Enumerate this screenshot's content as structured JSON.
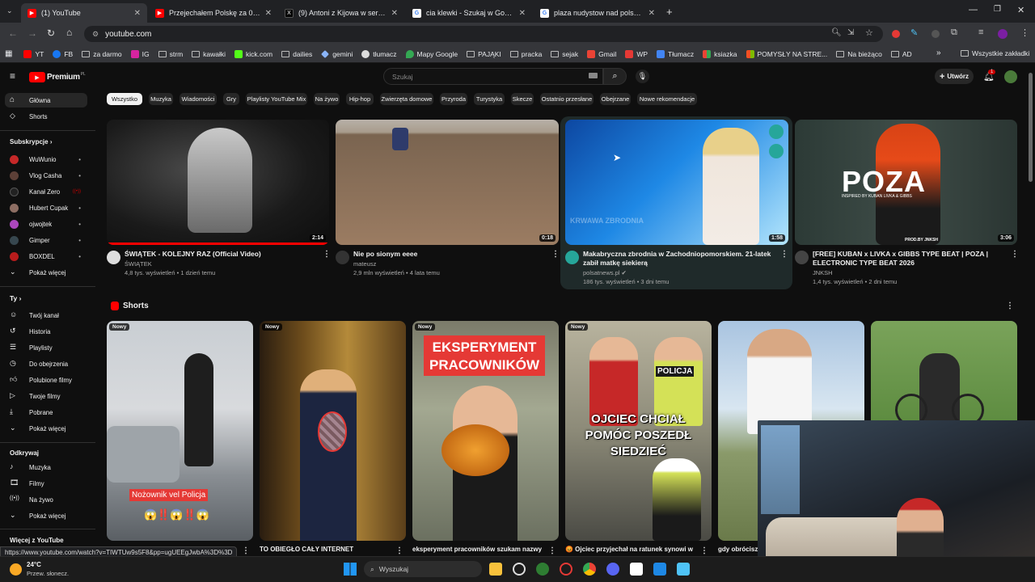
{
  "tabs": [
    {
      "title": "(1) YouTube",
      "favicon": "youtube-icon"
    },
    {
      "title": "Przejechałem Polskę za 0zł jako...",
      "favicon": "youtube-icon"
    },
    {
      "title": "(9) Antoni z Kijowa w serwisie X",
      "favicon": "x-icon"
    },
    {
      "title": "cia klewki - Szukaj w Google",
      "favicon": "google-icon"
    },
    {
      "title": "plaza nudystow nad polskim m...",
      "favicon": "google-icon"
    }
  ],
  "address": {
    "url": "youtube.com"
  },
  "bookmarks": [
    "YT",
    "FB",
    "za darmo",
    "IG",
    "strm",
    "kawałki",
    "kick.com",
    "dailies",
    "gemini",
    "tłumacz",
    "Mapy Google",
    "PAJĄKI",
    "pracka",
    "sejak",
    "Gmail",
    "WP",
    "Tłumacz",
    "ksiazka",
    "POMYSŁY NA STRE...",
    "Na bieżąco",
    "AD"
  ],
  "bookmarks_all": "Wszystkie zakładki",
  "yt": {
    "logo": "Premium",
    "logo_sup": "PL",
    "search_placeholder": "Szukaj",
    "create_label": "Utwórz",
    "notif_count": "1"
  },
  "sidebar": {
    "home": "Główna",
    "shorts": "Shorts",
    "subs_header": "Subskrypcje",
    "subs": [
      "WuWunio",
      "Vlog Casha",
      "Kanał Zero",
      "Hubert Cupak",
      "ojwojtek",
      "Gimper",
      "BOXDEL"
    ],
    "show_more": "Pokaż więcej",
    "you_header": "Ty",
    "you_items": [
      "Twój kanał",
      "Historia",
      "Playlisty",
      "Do obejrzenia",
      "Polubione filmy",
      "Twoje filmy",
      "Pobrane"
    ],
    "explore_header": "Odkrywaj",
    "explore_items": [
      "Muzyka",
      "Filmy",
      "Na żywo"
    ],
    "more_header": "Więcej z YouTube"
  },
  "chips": [
    "Wszystko",
    "Muzyka",
    "Wiadomości",
    "Gry",
    "Playlisty YouTube Mix",
    "Na żywo",
    "Hip-hop",
    "Zwierzęta domowe",
    "Przyroda",
    "Turystyka",
    "Skecze",
    "Ostatnio przesłane",
    "Obejrzane",
    "Nowe rekomendacje"
  ],
  "videos": [
    {
      "title": "ŚWIĄTEK - KOLEJNY RAZ (Official Video)",
      "channel": "ŚWIĄTEK",
      "meta": "4,8 tys. wyświetleń • 1 dzień temu",
      "duration": "2:14"
    },
    {
      "title": "Nie po sionym eeee",
      "channel": "mateusz",
      "meta": "2,9 mln wyświetleń • 4 lata temu",
      "duration": "0:18"
    },
    {
      "title": "Makabryczna zbrodnia w Zachodniopomorskiem. 21-latek zabił matkę siekierą",
      "channel": "polsatnews.pl",
      "meta": "186 tys. wyświetleń • 3 dni temu",
      "duration": "1:58",
      "overlay": "KRWAWA ZBRODNIA"
    },
    {
      "title": "[FREE] KUBAN x LIVKA x GIBBS TYPE BEAT | POZA | ELECTRONIC TYPE BEAT 2026",
      "channel": "JNKSH",
      "meta": "1,4 tys. wyświetleń • 2 dni temu",
      "duration": "3:06",
      "overlay": "POZA",
      "overlay_sub": "INSPIRED BY KUBAN LIVKA & GIBBS",
      "overlay_prod": "PROD.BY JNKSH"
    }
  ],
  "shorts_header": "Shorts",
  "shorts": [
    {
      "badge": "Nowy",
      "title": "",
      "overlay": "Nożownik vel Policja",
      "emoji": "😱‼️😱‼️😱"
    },
    {
      "badge": "Nowy",
      "title": "TO OBIEGŁO CAŁY INTERNET"
    },
    {
      "badge": "Nowy",
      "title": "eksperyment pracowników szukam nazwy...",
      "overlay": "EKSPERYMENT PRACOWNIKÓW"
    },
    {
      "badge": "Nowy",
      "title": "😡 Ojciec przyjechał na ratunek synowi w",
      "overlay": "OJCIEC CHCIAŁ POMÓC POSZEDŁ SIEDZIEĆ",
      "police": "POLICJA"
    },
    {
      "badge": "",
      "title": "gdy obrócisz s"
    },
    {
      "badge": "",
      "title": ""
    }
  ],
  "status_url": "https://www.youtube.com/watch?v=TIWTUw9s5F8&pp=ugUEEgJwbA%3D%3D",
  "taskbar": {
    "temp": "24°C",
    "weather": "Przew. słonecz.",
    "search": "Wyszukaj"
  }
}
